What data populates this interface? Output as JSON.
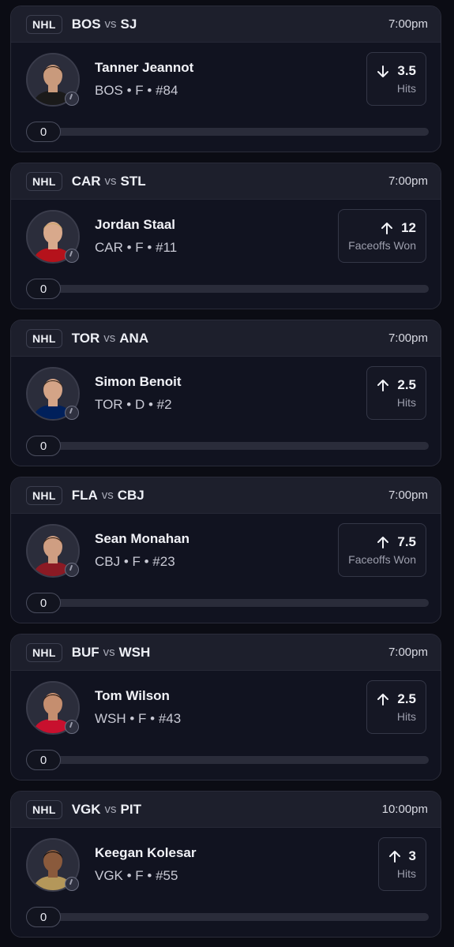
{
  "cards": [
    {
      "league": "NHL",
      "team_a": "BOS",
      "vs": "vs",
      "team_b": "SJ",
      "time": "7:00pm",
      "player": "Tanner Jeannot",
      "meta": "BOS • F • #84",
      "direction": "down",
      "line": "3.5",
      "stat": "Hits",
      "progress": "0",
      "skin": "#c99a7c",
      "hair": "#2a1c14",
      "jersey": "#1a1a1a"
    },
    {
      "league": "NHL",
      "team_a": "CAR",
      "vs": "vs",
      "team_b": "STL",
      "time": "7:00pm",
      "player": "Jordan Staal",
      "meta": "CAR • F • #11",
      "direction": "up",
      "line": "12",
      "stat": "Faceoffs Won",
      "progress": "0",
      "skin": "#d8a98c",
      "hair": "#caa56a",
      "jersey": "#b5121b"
    },
    {
      "league": "NHL",
      "team_a": "TOR",
      "vs": "vs",
      "team_b": "ANA",
      "time": "7:00pm",
      "player": "Simon Benoit",
      "meta": "TOR • D • #2",
      "direction": "up",
      "line": "2.5",
      "stat": "Hits",
      "progress": "0",
      "skin": "#d4a487",
      "hair": "#3a2a1e",
      "jersey": "#00205b"
    },
    {
      "league": "NHL",
      "team_a": "FLA",
      "vs": "vs",
      "team_b": "CBJ",
      "time": "7:00pm",
      "player": "Sean Monahan",
      "meta": "CBJ • F • #23",
      "direction": "up",
      "line": "7.5",
      "stat": "Faceoffs Won",
      "progress": "0",
      "skin": "#cf9e82",
      "hair": "#3b2618",
      "jersey": "#8b1a24"
    },
    {
      "league": "NHL",
      "team_a": "BUF",
      "vs": "vs",
      "team_b": "WSH",
      "time": "7:00pm",
      "player": "Tom Wilson",
      "meta": "WSH • F • #43",
      "direction": "up",
      "line": "2.5",
      "stat": "Hits",
      "progress": "0",
      "skin": "#c58e6f",
      "hair": "#2b1d16",
      "jersey": "#c8102e"
    },
    {
      "league": "NHL",
      "team_a": "VGK",
      "vs": "vs",
      "team_b": "PIT",
      "time": "10:00pm",
      "player": "Keegan Kolesar",
      "meta": "VGK • F • #55",
      "direction": "up",
      "line": "3",
      "stat": "Hits",
      "progress": "0",
      "skin": "#8a5a3c",
      "hair": "#141010",
      "jersey": "#b4975a"
    }
  ]
}
